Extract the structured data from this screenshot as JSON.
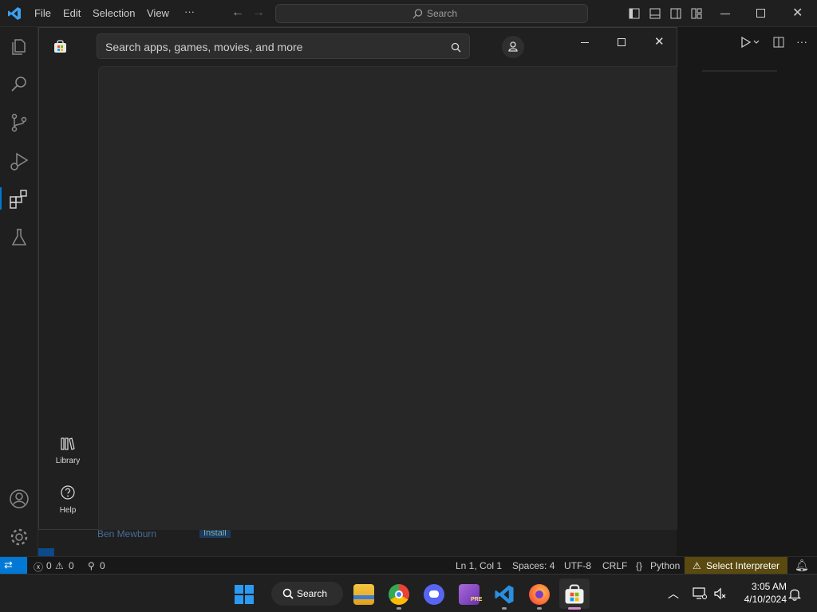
{
  "vscode": {
    "menu": [
      "File",
      "Edit",
      "Selection",
      "View",
      "···"
    ],
    "search_label": "Search",
    "background_author": "Ben Mewburn",
    "background_install": "Install"
  },
  "store": {
    "search_placeholder": "Search apps, games, movies, and more",
    "nav": {
      "library": "Library",
      "help": "Help"
    }
  },
  "statusbar": {
    "errors": "0",
    "warnings": "0",
    "ports": "0",
    "position": "Ln 1, Col 1",
    "spaces": "Spaces: 4",
    "encoding": "UTF-8",
    "eol": "CRLF",
    "language": "Python",
    "interpreter": "Select Interpreter"
  },
  "taskbar": {
    "search_label": "Search",
    "time": "3:05 AM",
    "date": "4/10/2024"
  },
  "colors": {
    "accent": "#0078d4",
    "warning_bg": "#5a4a10"
  }
}
